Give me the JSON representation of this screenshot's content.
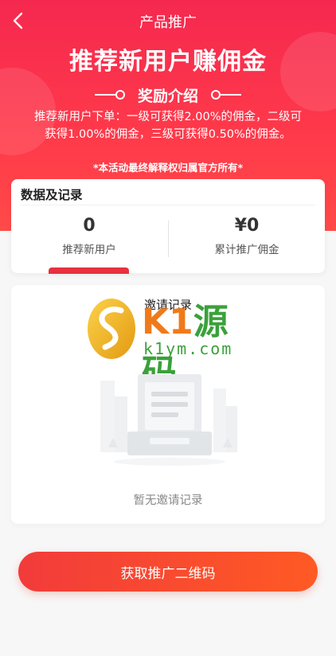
{
  "nav": {
    "title": "产品推广",
    "back_icon": "chevron-left-icon"
  },
  "hero": {
    "headline": "推荐新用户赚佣金",
    "reward_title": "奖励介绍",
    "reward_desc": "推荐新用户下单：一级可获得2.00%的佣金，二级可获得1.00%的佣金，三级可获得0.50%的佣金。",
    "disclaimer": "*本活动最终解释权归属官方所有*"
  },
  "stats": {
    "title": "数据及记录",
    "referred_value": "0",
    "referred_label": "推荐新用户",
    "commission_value": "¥0",
    "commission_label": "累计推广佣金"
  },
  "records": {
    "title": "邀请记录",
    "empty_text": "暂无邀请记录"
  },
  "watermark": {
    "brand_k": "K1",
    "brand_cn": "源码",
    "url": "k1ym.com"
  },
  "button": {
    "qr_label": "获取推广二维码"
  },
  "colors": {
    "primary": "#f5284f",
    "accent": "#e8313e",
    "button_end": "#ff5a24"
  }
}
